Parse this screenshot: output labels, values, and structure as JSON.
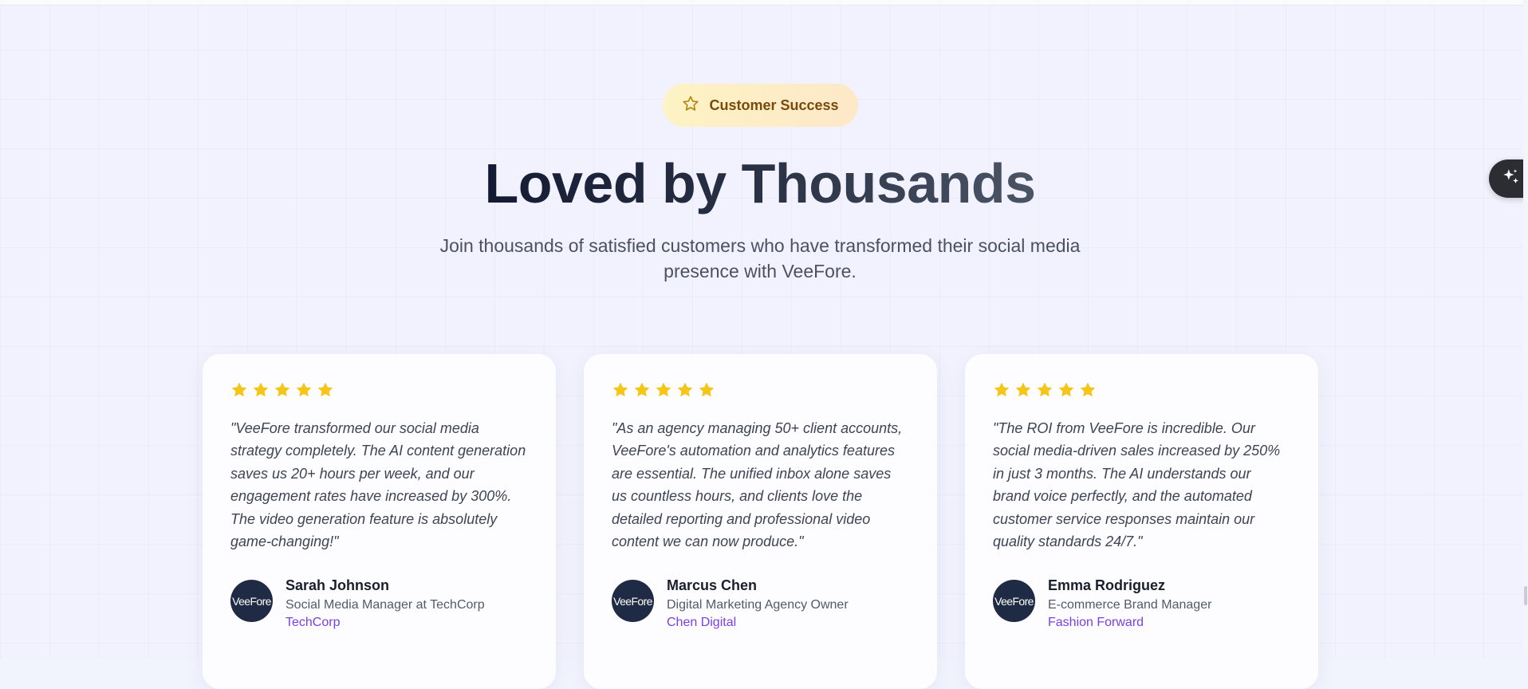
{
  "section": {
    "badge": {
      "icon": "star-outline-icon",
      "label": "Customer Success"
    },
    "title": "Loved by Thousands",
    "subtitle": "Join thousands of satisfied customers who have transformed their social media presence with VeeFore."
  },
  "floating_button": {
    "icon": "sparkles-icon"
  },
  "colors": {
    "star": "#f5c518",
    "badge_text": "#7a4a0c",
    "accent_company": "#7b3fe4",
    "avatar_bg": "#1f2a44"
  },
  "testimonials": [
    {
      "rating": 5,
      "quote": "\"VeeFore transformed our social media strategy completely. The AI content generation saves us 20+ hours per week, and our engagement rates have increased by 300%. The video generation feature is absolutely game-changing!\"",
      "avatar_text": "VeeFore",
      "name": "Sarah Johnson",
      "role": "Social Media Manager at TechCorp",
      "company": "TechCorp"
    },
    {
      "rating": 5,
      "quote": "\"As an agency managing 50+ client accounts, VeeFore's automation and analytics features are essential. The unified inbox alone saves us countless hours, and clients love the detailed reporting and professional video content we can now produce.\"",
      "avatar_text": "VeeFore",
      "name": "Marcus Chen",
      "role": "Digital Marketing Agency Owner",
      "company": "Chen Digital"
    },
    {
      "rating": 5,
      "quote": "\"The ROI from VeeFore is incredible. Our social media-driven sales increased by 250% in just 3 months. The AI understands our brand voice perfectly, and the automated customer service responses maintain our quality standards 24/7.\"",
      "avatar_text": "VeeFore",
      "name": "Emma Rodriguez",
      "role": "E-commerce Brand Manager",
      "company": "Fashion Forward"
    }
  ]
}
